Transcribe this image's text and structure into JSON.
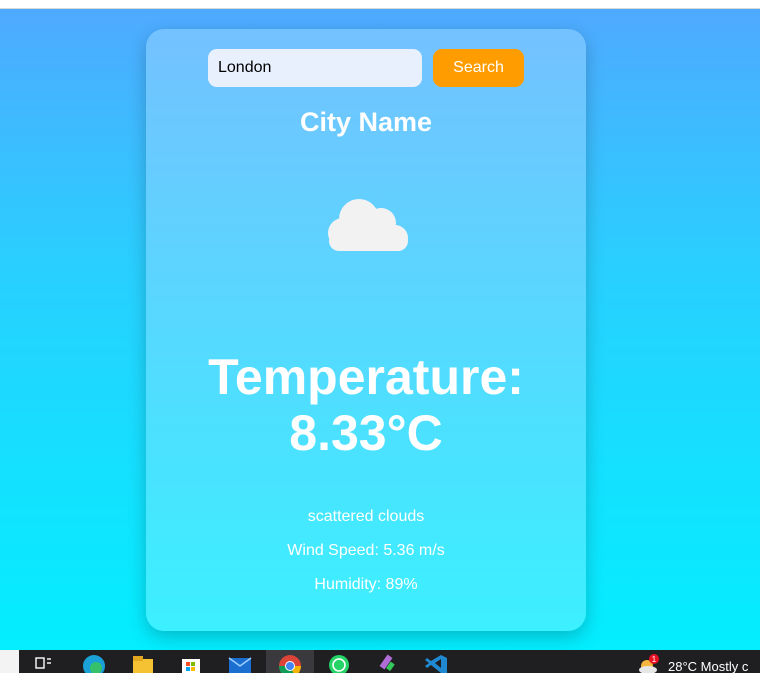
{
  "search": {
    "value": "London",
    "button_label": "Search"
  },
  "weather": {
    "city": "City Name",
    "icon": "cloud-icon",
    "temperature_line1": "Temperature:",
    "temperature_line2": "8.33°C",
    "description": "scattered clouds",
    "wind": "Wind Speed: 5.36 m/s",
    "humidity": "Humidity: 89%"
  },
  "taskbar": {
    "apps": [
      "task-view-icon",
      "edge-icon",
      "file-explorer-icon",
      "store-icon",
      "mail-icon",
      "chrome-icon",
      "whatsapp-icon",
      "paint-icon",
      "vscode-icon"
    ],
    "weather_badge": "1",
    "weather_text": "28°C  Mostly c"
  },
  "colors": {
    "button": "#ff9c00",
    "gradient_top": "#4faaff",
    "gradient_bottom": "#03eeff"
  }
}
